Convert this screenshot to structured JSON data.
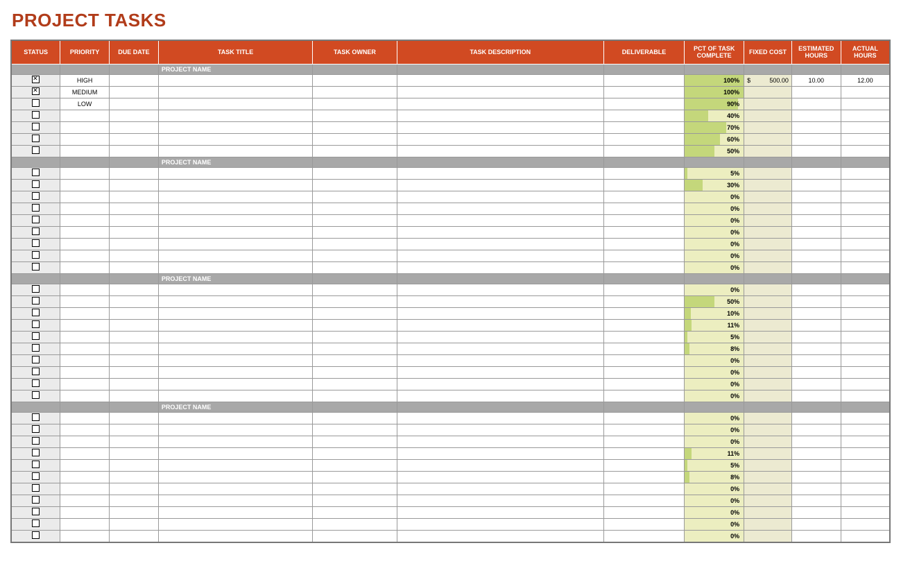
{
  "title": "PROJECT TASKS",
  "columns": [
    "STATUS",
    "PRIORITY",
    "DUE DATE",
    "TASK TITLE",
    "TASK OWNER",
    "TASK DESCRIPTION",
    "DELIVERABLE",
    "PCT OF TASK COMPLETE",
    "FIXED COST",
    "ESTIMATED HOURS",
    "ACTUAL HOURS"
  ],
  "groupLabel": "PROJECT NAME",
  "groups": [
    {
      "rows": [
        {
          "checked": true,
          "priority": "HIGH",
          "pct": 100,
          "cost": "500.00",
          "est": "10.00",
          "act": "12.00"
        },
        {
          "checked": true,
          "priority": "MEDIUM",
          "pct": 100
        },
        {
          "checked": false,
          "priority": "LOW",
          "pct": 90
        },
        {
          "checked": false,
          "pct": 40
        },
        {
          "checked": false,
          "pct": 70
        },
        {
          "checked": false,
          "pct": 60
        },
        {
          "checked": false,
          "pct": 50
        }
      ]
    },
    {
      "rows": [
        {
          "checked": false,
          "pct": 5
        },
        {
          "checked": false,
          "pct": 30
        },
        {
          "checked": false,
          "pct": 0
        },
        {
          "checked": false,
          "pct": 0
        },
        {
          "checked": false,
          "pct": 0
        },
        {
          "checked": false,
          "pct": 0
        },
        {
          "checked": false,
          "pct": 0
        },
        {
          "checked": false,
          "pct": 0
        },
        {
          "checked": false,
          "pct": 0
        }
      ]
    },
    {
      "rows": [
        {
          "checked": false,
          "pct": 0
        },
        {
          "checked": false,
          "pct": 50
        },
        {
          "checked": false,
          "pct": 10
        },
        {
          "checked": false,
          "pct": 11
        },
        {
          "checked": false,
          "pct": 5
        },
        {
          "checked": false,
          "pct": 8
        },
        {
          "checked": false,
          "pct": 0
        },
        {
          "checked": false,
          "pct": 0
        },
        {
          "checked": false,
          "pct": 0
        },
        {
          "checked": false,
          "pct": 0
        }
      ]
    },
    {
      "rows": [
        {
          "checked": false,
          "pct": 0
        },
        {
          "checked": false,
          "pct": 0
        },
        {
          "checked": false,
          "pct": 0
        },
        {
          "checked": false,
          "pct": 11
        },
        {
          "checked": false,
          "pct": 5
        },
        {
          "checked": false,
          "pct": 8
        },
        {
          "checked": false,
          "pct": 0
        },
        {
          "checked": false,
          "pct": 0
        },
        {
          "checked": false,
          "pct": 0
        },
        {
          "checked": false,
          "pct": 0
        },
        {
          "checked": false,
          "pct": 0
        }
      ]
    }
  ]
}
